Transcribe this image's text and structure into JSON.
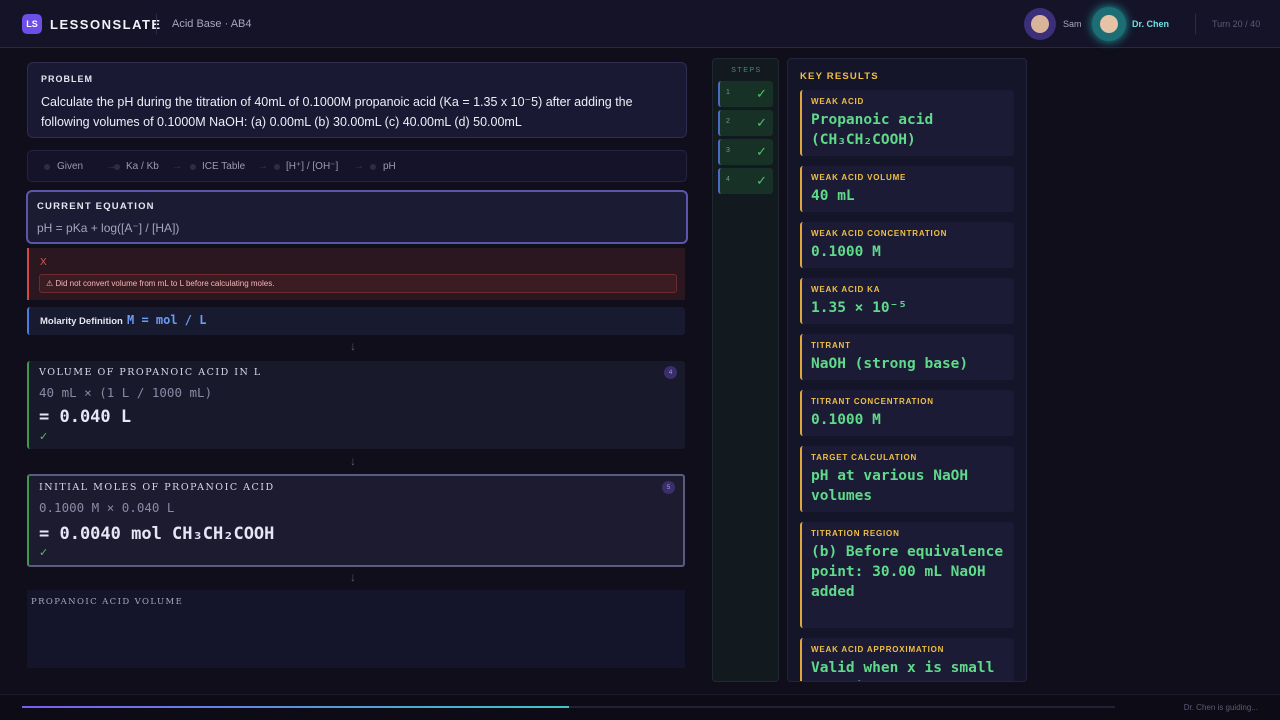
{
  "header": {
    "logo": "LS",
    "brand": "LESSONSLATE",
    "title": "Acid Base · AB4",
    "participants": [
      {
        "name": "Sam"
      },
      {
        "name": "Dr. Chen"
      }
    ],
    "turn": "Turn 20 / 40"
  },
  "problem": {
    "label": "PROBLEM",
    "text": "Calculate the pH during the titration of 40mL of 0.1000M propanoic acid (Ka = 1.35 x 10⁻5) after adding the following volumes of 0.1000M NaOH: (a) 0.00mL (b) 30.00mL (c) 40.00mL (d) 50.00mL"
  },
  "steps_bar": {
    "items": [
      "Given",
      "Ka / Kb",
      "ICE Table",
      "[H⁺] / [OH⁻]",
      "pH"
    ]
  },
  "current_equation": {
    "label": "CURRENT EQUATION",
    "text": "pH = pKa + log([A⁻] / [HA])"
  },
  "error": {
    "mark": "X",
    "message": "⚠ Did not convert volume from mL to L before calculating moles."
  },
  "molarity": {
    "label": "Molarity Definition",
    "equation": "M = mol / L"
  },
  "cards": [
    {
      "title": "Volume of propanoic acid in L",
      "work": "40 mL × (1 L / 1000 mL)",
      "result": "= 0.040 L",
      "check": "✓",
      "number": "4"
    },
    {
      "title": "Initial moles of propanoic acid",
      "work": "0.1000 M × 0.040 L",
      "result": "= 0.0040 mol CH₃CH₂COOH",
      "check": "✓",
      "number": "5"
    }
  ],
  "next_card": {
    "title": "PROPANOIC ACID VOLUME"
  },
  "steps_panel": {
    "label": "STEPS",
    "steps": [
      {
        "num": "1",
        "check": "✓"
      },
      {
        "num": "2",
        "check": "✓"
      },
      {
        "num": "3",
        "check": "✓"
      },
      {
        "num": "4",
        "check": "✓"
      }
    ]
  },
  "key_results": {
    "label": "KEY RESULTS",
    "items": [
      {
        "label": "WEAK ACID",
        "value": "Propanoic acid (CH₃CH₂COOH)"
      },
      {
        "label": "WEAK ACID VOLUME",
        "value": "40 mL"
      },
      {
        "label": "WEAK ACID CONCENTRATION",
        "value": "0.1000 M"
      },
      {
        "label": "WEAK ACID KA",
        "value": "1.35 × 10⁻⁵"
      },
      {
        "label": "TITRANT",
        "value": "NaOH (strong base)"
      },
      {
        "label": "TITRANT CONCENTRATION",
        "value": "0.1000 M"
      },
      {
        "label": "TARGET CALCULATION",
        "value": "pH at various NaOH volumes"
      },
      {
        "label": "TITRATION REGION",
        "value": "(b) Before equivalence point: 30.00 mL NaOH added"
      },
      {
        "label": "WEAK ACID APPROXIMATION",
        "value": "Valid when x is small relative to"
      }
    ]
  },
  "footer": {
    "progress": 0.5,
    "status": "Dr. Chen is guiding..."
  },
  "colors": {
    "accent": "#6d4ee6",
    "success": "#4ec26a",
    "warning": "#f0c040",
    "error": "#d44848",
    "result_text": "#5fd98a"
  }
}
